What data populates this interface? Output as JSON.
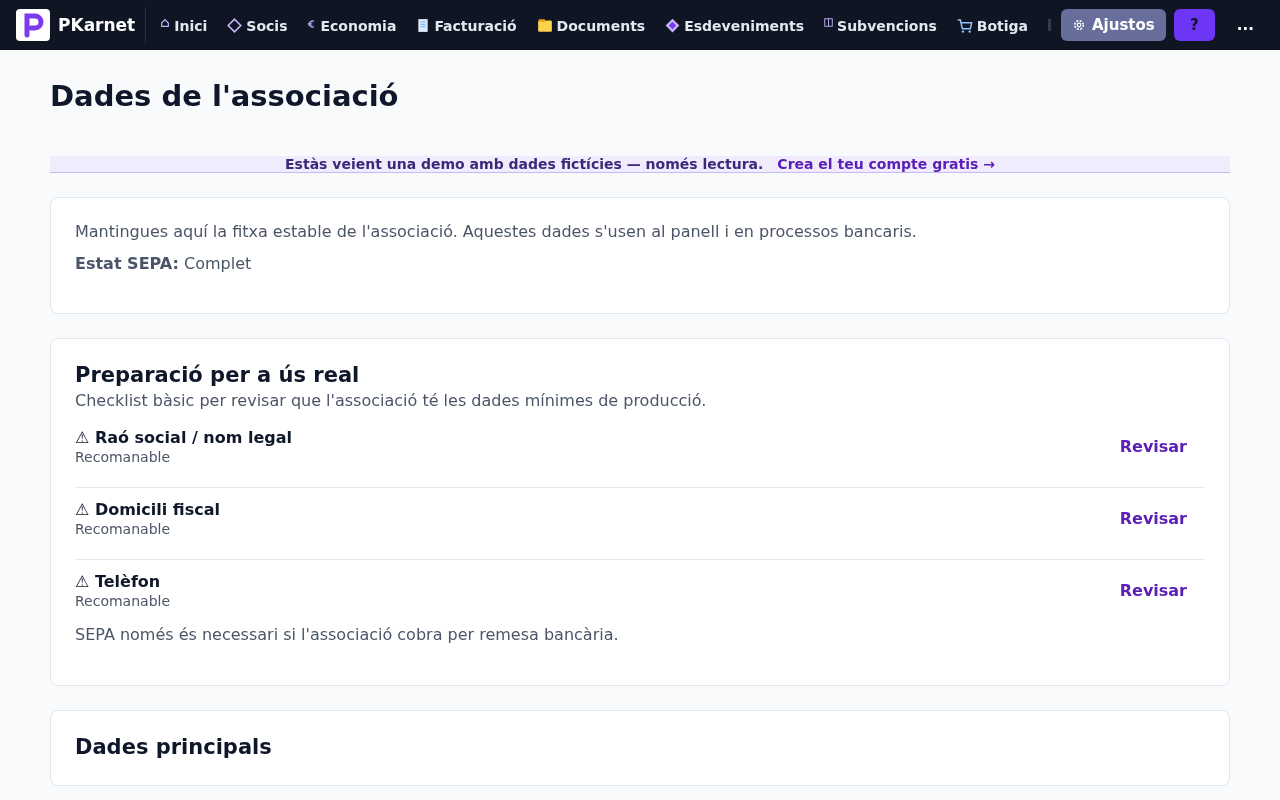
{
  "nav": {
    "brand": "PKarnet",
    "items": [
      {
        "label": "Inici"
      },
      {
        "label": "Socis"
      },
      {
        "label": "Economia"
      },
      {
        "label": "Facturació"
      },
      {
        "label": "Documents"
      },
      {
        "label": "Esdeveniments"
      },
      {
        "label": "Subvencions"
      },
      {
        "label": "Botiga"
      }
    ],
    "settings": "Ajustos",
    "help": "?",
    "more": "..."
  },
  "page_title": "Dades de l'associació",
  "demo_banner": {
    "text": "Estàs veient una demo amb dades fictícies — només lectura.",
    "link": "Crea el teu compte gratis →"
  },
  "intro_card": {
    "text": "Mantingues aquí la fitxa estable de l'associació. Aquestes dades s'usen al panell i en processos bancaris.",
    "status_label": "Estat SEPA:",
    "status_value": "Complet"
  },
  "checklist": {
    "title": "Preparació per a ús real",
    "subtitle": "Checklist bàsic per revisar que l'associació té les dades mínimes de producció.",
    "items": [
      {
        "title": "⚠ Raó social / nom legal",
        "note": "Recomanable",
        "action": "Revisar"
      },
      {
        "title": "⚠ Domicili fiscal",
        "note": "Recomanable",
        "action": "Revisar"
      },
      {
        "title": "⚠ Telèfon",
        "note": "Recomanable",
        "action": "Revisar"
      }
    ],
    "footnote": "SEPA només és necessari si l'associació cobra per remesa bancària."
  },
  "main_card": {
    "title": "Dades principals"
  }
}
